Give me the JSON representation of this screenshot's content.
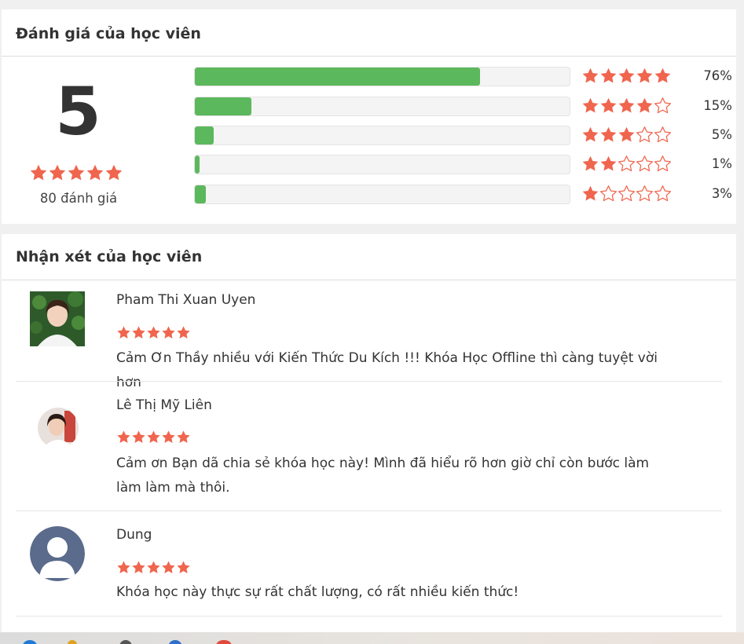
{
  "rating_section": {
    "title": "Đánh giá của học viên",
    "score": "5",
    "score_stars": 5,
    "count_label": "80 đánh giá",
    "breakdown": [
      {
        "stars": 5,
        "percent": 76,
        "label": "76%"
      },
      {
        "stars": 4,
        "percent": 15,
        "label": "15%"
      },
      {
        "stars": 3,
        "percent": 5,
        "label": "5%"
      },
      {
        "stars": 2,
        "percent": 1,
        "label": "1%"
      },
      {
        "stars": 1,
        "percent": 3,
        "label": "3%"
      }
    ]
  },
  "reviews_section": {
    "title": "Nhận xét của học viên",
    "reviews": [
      {
        "name": "Pham Thi Xuan Uyen",
        "stars": 5,
        "text": "Cảm Ơn Thầy nhiều với Kiến Thức Du Kích !!! Khóa Học Offline thì càng tuyệt vời hơn",
        "avatar": "photo-square"
      },
      {
        "name": "Lê Thị Mỹ Liên",
        "stars": 5,
        "text": "Cảm ơn Bạn dã chia sẻ khóa học này! Mình đã hiểu rõ hơn giờ chỉ còn bước làm làm làm mà thôi.",
        "avatar": "photo-round"
      },
      {
        "name": "Dung",
        "stars": 5,
        "text": "Khóa học này thực sự rất chất lượng, có rất nhiều kiến thức!",
        "avatar": "default-user-icon"
      }
    ]
  },
  "colors": {
    "star": "#f0654e",
    "bar_fill": "#5cb85c",
    "bar_track": "#f4f4f4"
  }
}
